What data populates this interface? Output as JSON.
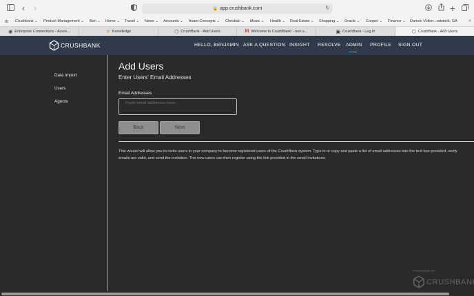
{
  "browser": {
    "url": "app.crushbank.com",
    "bookmarks": [
      "Crushbank",
      "Product Management",
      "Ben",
      "Home",
      "Travel",
      "News",
      "Accounts",
      "Avant Concepts",
      "Christian",
      "Music",
      "Health",
      "Real Estate",
      "Shopping",
      "Oracle",
      "Cooper",
      "Finance",
      "Damon Volker...odstock, GA"
    ],
    "tabs": [
      {
        "label": "Enterprise Connections - Azure...",
        "icon": "azure-icon"
      },
      {
        "label": "Knowledge",
        "icon": "knowledge-icon"
      },
      {
        "label": "CrushBank - Add Users",
        "icon": "crushbank-icon"
      },
      {
        "label": "Welcome to CrushBank! - ben.s...",
        "icon": "gmail-icon"
      },
      {
        "label": "CrushBank - Log In",
        "icon": "crushbank-login-icon"
      },
      {
        "label": "CrushBank - Add Users",
        "icon": "crushbank-icon",
        "active": true
      }
    ]
  },
  "header": {
    "logo_text": "CRUSHBANK",
    "nav": [
      "HELLO, BENJAMIN",
      "ASK A QUESTION",
      "INSIGHT",
      "RESOLVE",
      "ADMIN",
      "PROFILE",
      "SIGN OUT"
    ],
    "active_nav": "ADMIN",
    "accent_color": "#e67e22"
  },
  "sidebar": {
    "items": [
      "Data Import",
      "Users",
      "Agents"
    ]
  },
  "main": {
    "title": "Add Users",
    "subtitle": "Enter Users' Email Addresses",
    "field_label": "Email Addresses",
    "field_placeholder": "Paste email addresses here...",
    "field_value": "",
    "back_label": "Back",
    "next_label": "Next",
    "description_line1": "This wizard will allow you to invite users in your company to become registered users of the CrushBank system. Type in or copy and paste a list of email addresses into the text box provided, verify",
    "description_line2": "emails are valid, and send the invitation. The new users can then register using the link provided in the email invitations."
  },
  "footer": {
    "powered_by": "POWERED BY",
    "logo_text": "CRUSHBANK"
  }
}
